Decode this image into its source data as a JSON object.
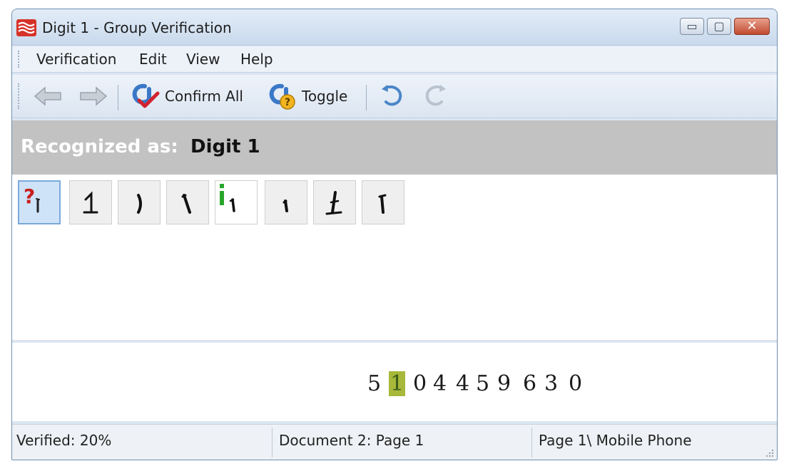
{
  "window": {
    "title": "Digit 1 - Group Verification"
  },
  "window_buttons": {
    "minimize": "▭",
    "maximize": "▢",
    "close": "✕"
  },
  "menu": {
    "items": [
      "Verification",
      "Edit",
      "View",
      "Help"
    ]
  },
  "toolbar": {
    "confirm_all": "Confirm All",
    "toggle": "Toggle"
  },
  "recognition": {
    "prefix": "Recognized as:",
    "value": "Digit 1"
  },
  "tiles": [
    {
      "glyph": "question-mark-icon",
      "state": "selected"
    },
    {
      "glyph": "handwritten-one"
    },
    {
      "glyph": "handwritten-one"
    },
    {
      "glyph": "handwritten-one"
    },
    {
      "glyph": "info-marker-icon",
      "state": "white"
    },
    {
      "glyph": "handwritten-one"
    },
    {
      "glyph": "handwritten-one"
    },
    {
      "glyph": "handwritten-one"
    }
  ],
  "context": {
    "digits": [
      "5",
      "1",
      "0",
      "4",
      "4",
      "5",
      "9",
      "6",
      "3",
      "0"
    ],
    "highlighted_index": 1
  },
  "status": {
    "verified": "Verified: 20%",
    "document": "Document 2: Page 1",
    "location": "Page 1\\ Mobile Phone"
  },
  "colors": {
    "accent_blue": "#3a78c8",
    "confirm_red": "#d0232f",
    "question_red": "#c8201e",
    "info_green": "#2aa62a",
    "band_gray": "#c2c2c2"
  }
}
